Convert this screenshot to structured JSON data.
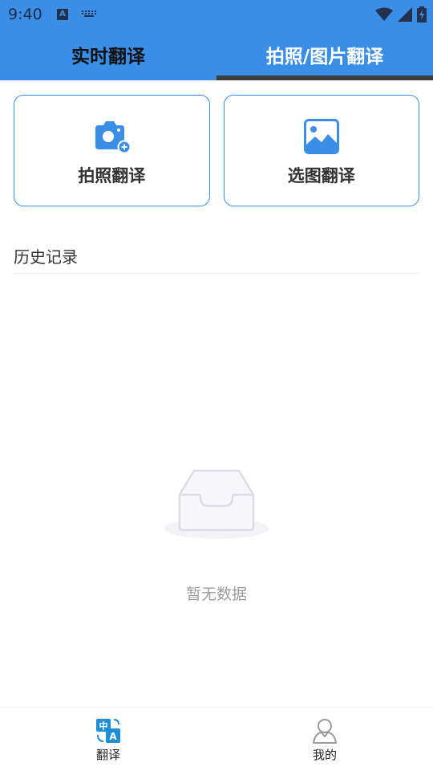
{
  "status_bar": {
    "time": "9:40",
    "notification_icon_a": "A"
  },
  "tabs": [
    {
      "label": "实时翻译",
      "active": false
    },
    {
      "label": "拍照/图片翻译",
      "active": true
    }
  ],
  "actions": {
    "photo": {
      "label": "拍照翻译",
      "icon": "camera-plus-icon"
    },
    "gallery": {
      "label": "选图翻译",
      "icon": "image-icon"
    }
  },
  "history": {
    "title": "历史记录",
    "empty_text": "暂无数据",
    "empty_icon": "empty-inbox-icon"
  },
  "bottom_nav": [
    {
      "label": "翻译",
      "icon": "translate-icon",
      "active": true
    },
    {
      "label": "我的",
      "icon": "user-icon",
      "active": false
    }
  ],
  "colors": {
    "primary": "#3a8ee6",
    "tab_indicator": "#3c3c3c",
    "text_dark": "#333333",
    "text_muted": "#9b9b9b"
  }
}
